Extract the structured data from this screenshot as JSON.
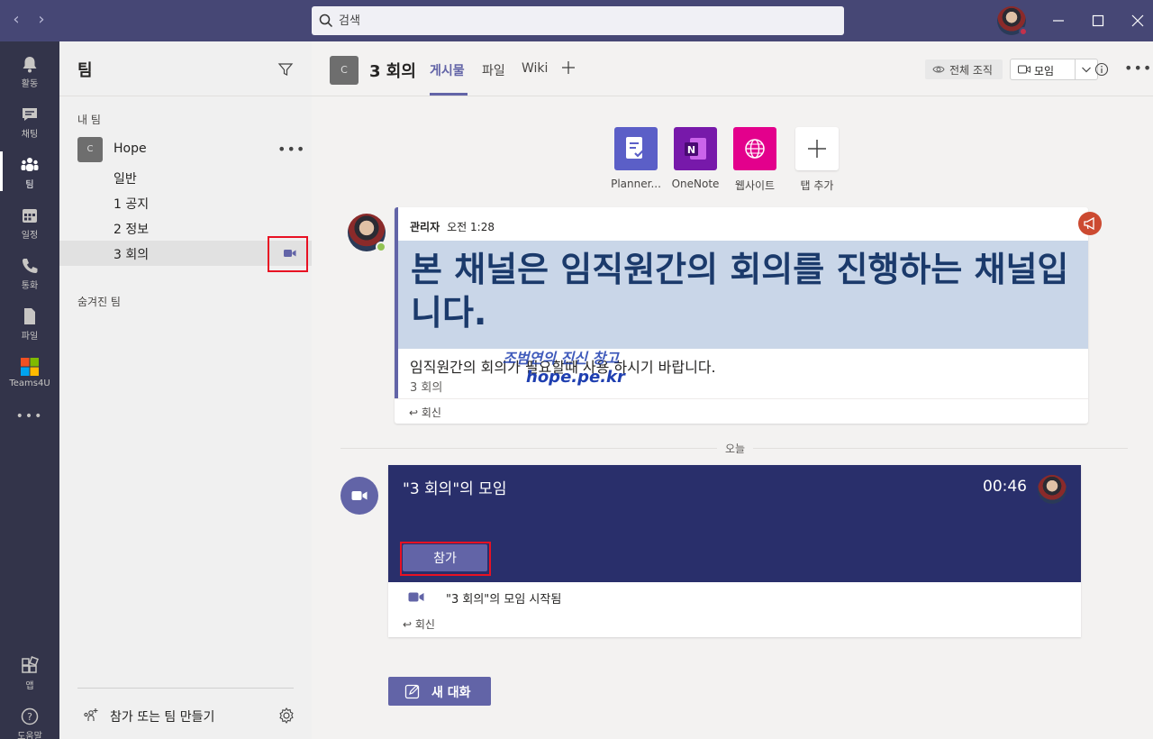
{
  "titlebar": {
    "search_placeholder": "검색",
    "back_label": "‹",
    "forward_label": "›"
  },
  "rail": {
    "items": [
      {
        "label": "활동",
        "icon": "bell-icon"
      },
      {
        "label": "채팅",
        "icon": "chat-icon"
      },
      {
        "label": "팀",
        "icon": "teams-icon"
      },
      {
        "label": "일정",
        "icon": "calendar-icon"
      },
      {
        "label": "통화",
        "icon": "phone-icon"
      },
      {
        "label": "파일",
        "icon": "file-icon"
      },
      {
        "label": "Teams4U",
        "icon": "teams4u-icon"
      },
      {
        "label": "앱",
        "icon": "apps-icon"
      },
      {
        "label": "도움말",
        "icon": "help-icon"
      }
    ],
    "more": "•••"
  },
  "teams_pane": {
    "title": "팀",
    "my_teams_label": "내 팀",
    "team": {
      "avatar": "C",
      "name": "Hope",
      "more": "•••"
    },
    "channels": [
      "일반",
      "1 공지",
      "2 정보",
      "3 회의"
    ],
    "hidden_teams_label": "숨겨진 팀",
    "join_create_label": "참가 또는 팀 만들기"
  },
  "channel_header": {
    "avatar": "C",
    "name": "3 회의",
    "tabs": [
      "게시물",
      "파일",
      "Wiki"
    ],
    "org_label": "전체 조직",
    "meet_label": "모임",
    "more": "•••"
  },
  "apps": [
    {
      "label": "Planner...",
      "color": "#5b5fc7"
    },
    {
      "label": "OneNote",
      "color": "#7719aa"
    },
    {
      "label": "웹사이트",
      "color": "#e3008c"
    },
    {
      "label": "탭 추가",
      "color": "#ffffff"
    }
  ],
  "post": {
    "author": "관리자",
    "time": "오전 1:28",
    "headline": "본 채널은 임직원간의 회의를 진행하는 채널입니다.",
    "body": "임직원간의 회의가 필요할때 사용 하시기 바랍니다.",
    "channel": "3 회의",
    "watermark_top": "조범연의 진신 창고",
    "watermark_url": "hope.pe.kr",
    "reply": "회신"
  },
  "divider_label": "오늘",
  "meeting": {
    "title": "\"3 회의\"의 모임",
    "time": "00:46",
    "join_label": "참가",
    "started": "\"3 회의\"의 모임 시작됨",
    "reply": "회신"
  },
  "new_conversation_label": "새 대화",
  "colors": {
    "titlebar": "#464775",
    "rail": "#33344a",
    "accent": "#6264a7",
    "meeting_banner": "#292f6b",
    "highlight_box": "#e81123"
  }
}
